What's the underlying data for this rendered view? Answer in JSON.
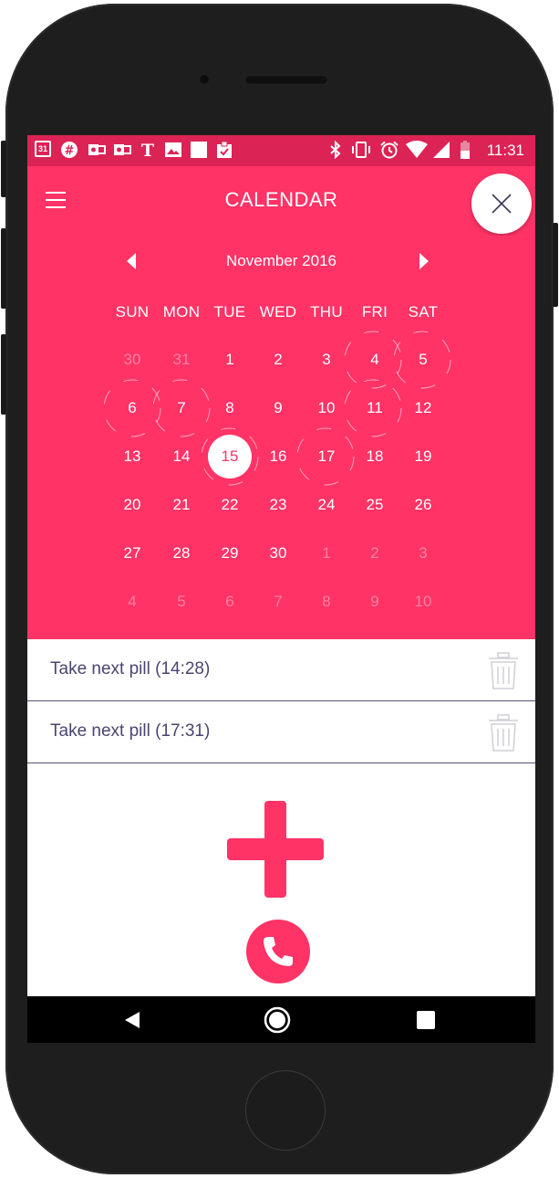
{
  "status_bar": {
    "calendar_badge": "31",
    "time": "11:31",
    "left_icons": [
      "calendar-icon",
      "slack-icon",
      "outlook-icon",
      "outlook-icon",
      "nytimes-icon",
      "image-icon",
      "square-icon",
      "clipboard-icon"
    ],
    "right_icons": [
      "bluetooth-icon",
      "vibrate-icon",
      "alarm-icon",
      "wifi-icon",
      "signal-icon",
      "battery-icon"
    ]
  },
  "app_bar": {
    "title": "CALENDAR"
  },
  "calendar": {
    "month_label": "November 2016",
    "weekdays": [
      "SUN",
      "MON",
      "TUE",
      "WED",
      "THU",
      "FRI",
      "SAT"
    ],
    "weeks": [
      [
        "30",
        "31",
        "1",
        "2",
        "3",
        "4",
        "5"
      ],
      [
        "6",
        "7",
        "8",
        "9",
        "10",
        "11",
        "12"
      ],
      [
        "13",
        "14",
        "15",
        "16",
        "17",
        "18",
        "19"
      ],
      [
        "20",
        "21",
        "22",
        "23",
        "24",
        "25",
        "26"
      ],
      [
        "27",
        "28",
        "29",
        "30",
        "1",
        "2",
        "3"
      ],
      [
        "4",
        "5",
        "6",
        "7",
        "8",
        "9",
        "10"
      ]
    ],
    "selected_day": "15"
  },
  "events": [
    {
      "label": "Take next pill (14:28)"
    },
    {
      "label": "Take next pill (17:31)"
    }
  ],
  "colors": {
    "accent": "#ff3366",
    "status_bar": "#db2355",
    "event_text": "#4a4570",
    "divider": "#55507a"
  }
}
